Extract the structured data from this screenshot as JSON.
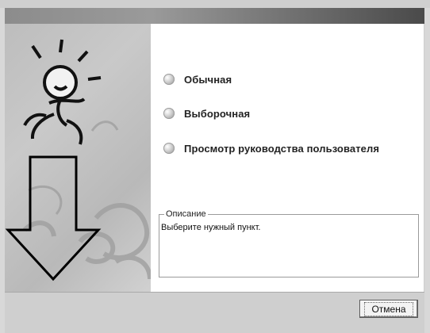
{
  "window": {
    "options": [
      {
        "label": "Обычная"
      },
      {
        "label": "Выборочная"
      },
      {
        "label": "Просмотр руководства пользователя"
      }
    ],
    "description": {
      "legend": "Описание",
      "text": "Выберите нужный пункт."
    },
    "footer": {
      "cancel_label": "Отмена"
    }
  }
}
